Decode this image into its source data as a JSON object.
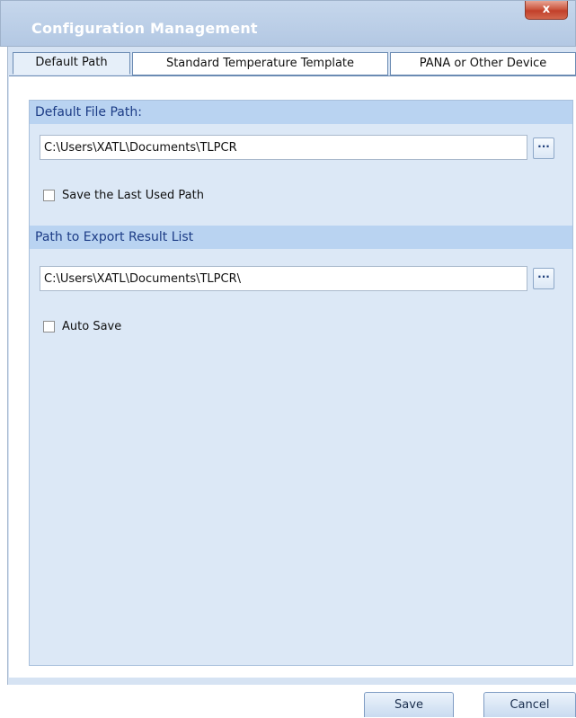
{
  "window": {
    "title": "Configuration Management",
    "close_label": "x"
  },
  "tabs": [
    {
      "label": "Default Path",
      "active": true
    },
    {
      "label": "Standard Temperature Template",
      "active": false
    },
    {
      "label": "PANA or Other Device",
      "active": false
    }
  ],
  "default_file_path": {
    "header": "Default File Path:",
    "value": "C:\\Users\\XATL\\Documents\\TLPCR",
    "browse_label": "···",
    "checkbox_label": "Save the Last Used Path",
    "checked": false
  },
  "export_path": {
    "header": "Path to Export Result List",
    "value": "C:\\Users\\XATL\\Documents\\TLPCR\\",
    "browse_label": "···",
    "checkbox_label": "Auto Save",
    "checked": false
  },
  "footer": {
    "save_label": "Save",
    "cancel_label": "Cancel"
  },
  "colors": {
    "title_bar": "#b3c8e3",
    "section_header": "#b9d3f1",
    "section_text": "#1c3c86",
    "panel_background": "#dce8f6",
    "close_button": "#c2402a"
  }
}
